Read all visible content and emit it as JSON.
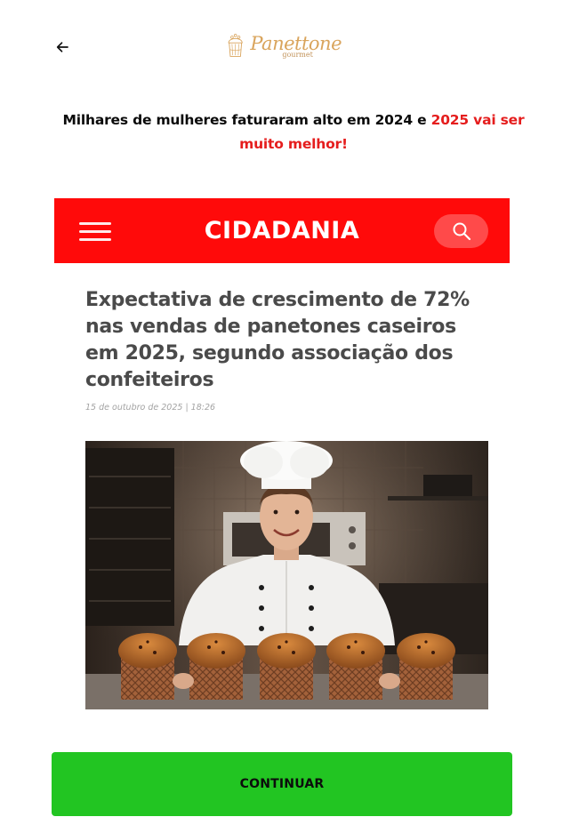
{
  "header": {
    "back_icon": "arrow-left-icon",
    "logo": {
      "word": "Panettone",
      "sub": "gourmet",
      "color": "#d9a45c"
    }
  },
  "headline": {
    "part1": "Milhares de mulheres faturaram alto em 2024 e ",
    "part2_highlight": "2025 vai ser muito melhor!",
    "highlight_color": "#e51d1d"
  },
  "news": {
    "brand": "CIDADANIA",
    "bar_color": "#ff0a0a",
    "menu_icon": "hamburger-menu-icon",
    "search_icon": "search-icon",
    "title": "Expectativa de crescimento de 72% nas vendas de panetones caseiros em 2025, segundo associação dos confeiteiros",
    "date": "15 de outubro de 2025 | 18:26"
  },
  "cta": {
    "label": "CONTINUAR",
    "color": "#22c522"
  }
}
